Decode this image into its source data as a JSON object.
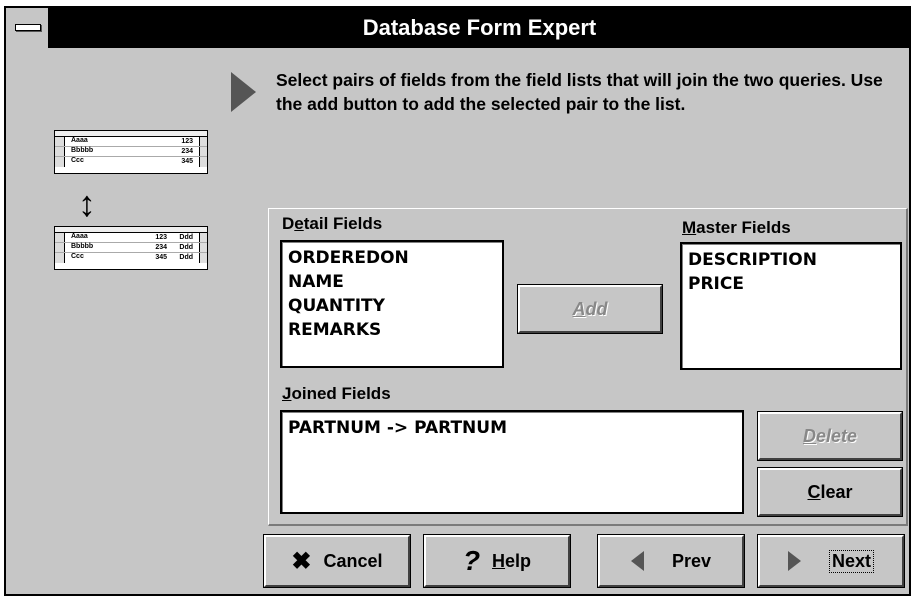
{
  "window": {
    "title": "Database Form Expert"
  },
  "instruction": "Select pairs of fields from the field lists that will join the two queries.  Use the add button to add the selected pair to the list.",
  "illustration": {
    "top_rows": [
      {
        "name": "Aaaa",
        "value": "123"
      },
      {
        "name": "Bbbbb",
        "value": "234"
      },
      {
        "name": "Ccc",
        "value": "345"
      }
    ],
    "bottom_rows": [
      {
        "name": "Aaaa",
        "value": "123",
        "extra": "Ddd"
      },
      {
        "name": "Bbbbb",
        "value": "234",
        "extra": "Ddd"
      },
      {
        "name": "Ccc",
        "value": "345",
        "extra": "Ddd"
      }
    ]
  },
  "detail": {
    "label_pre": "D",
    "label_mnemonic": "e",
    "label_post": "tail Fields",
    "items": [
      "ORDEREDON",
      "NAME",
      "QUANTITY",
      "REMARKS"
    ]
  },
  "master": {
    "label_mnemonic": "M",
    "label_post": "aster Fields",
    "items": [
      "DESCRIPTION",
      "PRICE"
    ]
  },
  "joined": {
    "label_mnemonic": "J",
    "label_post": "oined Fields",
    "items": [
      "PARTNUM -> PARTNUM"
    ]
  },
  "buttons": {
    "add": {
      "mnemonic": "A",
      "rest": "dd"
    },
    "delete": {
      "mnemonic": "D",
      "rest": "elete"
    },
    "clear": {
      "mnemonic": "C",
      "rest": "lear"
    },
    "cancel": {
      "label": "Cancel",
      "icon": "x-icon"
    },
    "help": {
      "mnemonic": "H",
      "rest": "elp",
      "icon": "question-icon"
    },
    "prev": {
      "label": "Prev",
      "icon": "triangle-left-icon"
    },
    "next": {
      "label": "Next",
      "icon": "triangle-right-icon"
    }
  },
  "colors": {
    "face": "#c6c6c6",
    "titlebar": "#000000",
    "disabled_text": "#888888"
  }
}
